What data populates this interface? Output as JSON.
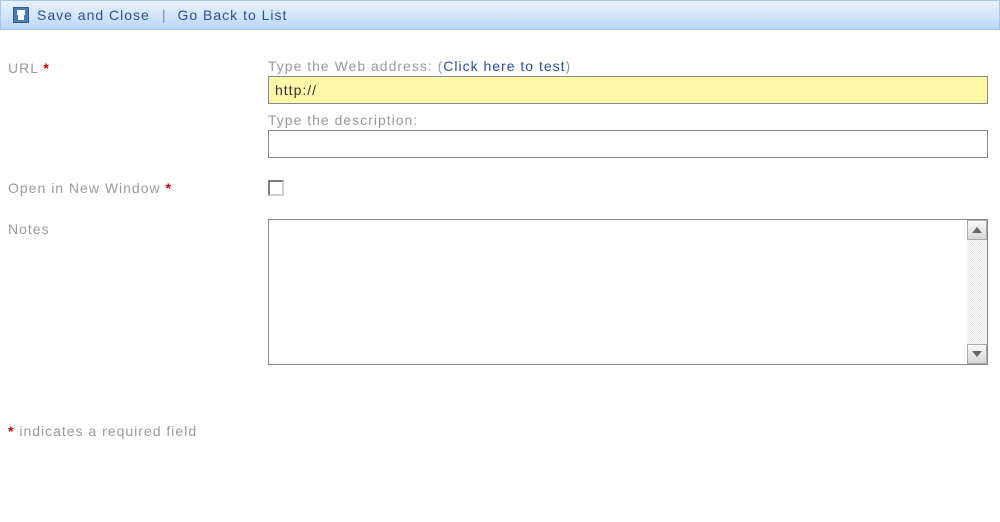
{
  "toolbar": {
    "save_label": "Save and Close",
    "separator": "|",
    "back_label": "Go Back to List"
  },
  "fields": {
    "url": {
      "label": "URL",
      "required_mark": "*",
      "address_label": "Type the Web address: (",
      "test_link_label": "Click here to test",
      "address_label_close": ")",
      "address_value": "http://",
      "description_label": "Type the description:",
      "description_value": ""
    },
    "open_new_window": {
      "label": "Open in New Window",
      "required_mark": "*",
      "checked": false
    },
    "notes": {
      "label": "Notes",
      "value": ""
    }
  },
  "footer": {
    "required_mark": "*",
    "required_text": " indicates a required field"
  }
}
